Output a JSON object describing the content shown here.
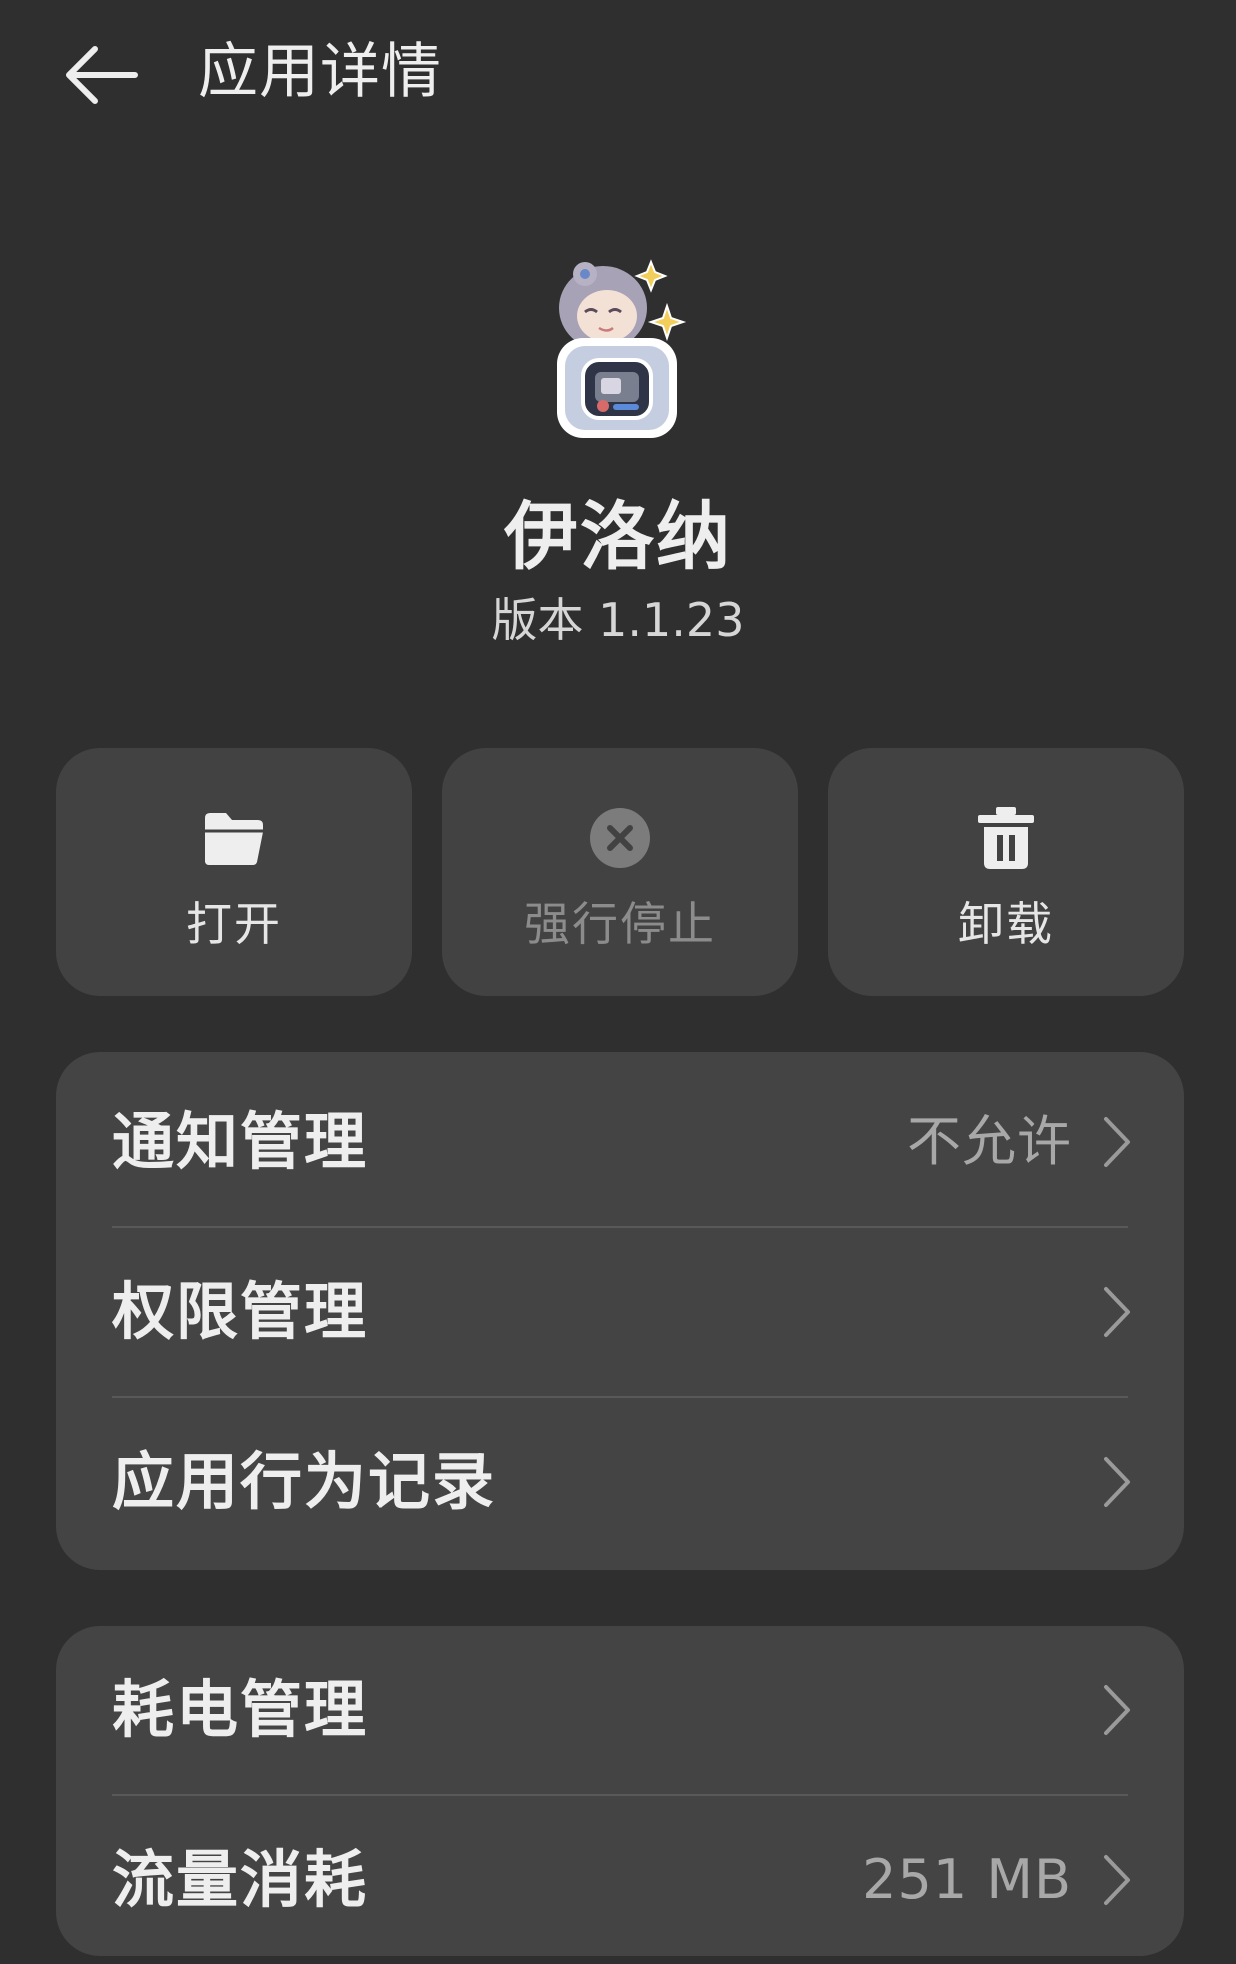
{
  "header": {
    "title": "应用详情",
    "back_icon": "back-arrow-icon"
  },
  "app": {
    "name": "伊洛纳",
    "version": "版本 1.1.23",
    "icon": "app-icon"
  },
  "actions": [
    {
      "label": "打开",
      "icon": "folder-open-icon",
      "enabled": true
    },
    {
      "label": "强行停止",
      "icon": "close-circle-icon",
      "enabled": false
    },
    {
      "label": "卸载",
      "icon": "trash-icon",
      "enabled": true
    }
  ],
  "settings_card_1": {
    "items": [
      {
        "label": "通知管理",
        "value": "不允许"
      },
      {
        "label": "权限管理",
        "value": ""
      },
      {
        "label": "应用行为记录",
        "value": ""
      }
    ]
  },
  "settings_card_2": {
    "items": [
      {
        "label": "耗电管理",
        "value": ""
      },
      {
        "label": "流量消耗",
        "value": "251 MB"
      }
    ]
  },
  "colors": {
    "background": "#2f2f2f",
    "card": "#444444",
    "button": "#424242",
    "text_primary": "#eeeeee",
    "text_secondary": "#a8a8a8",
    "disabled": "#8c8c8c"
  }
}
